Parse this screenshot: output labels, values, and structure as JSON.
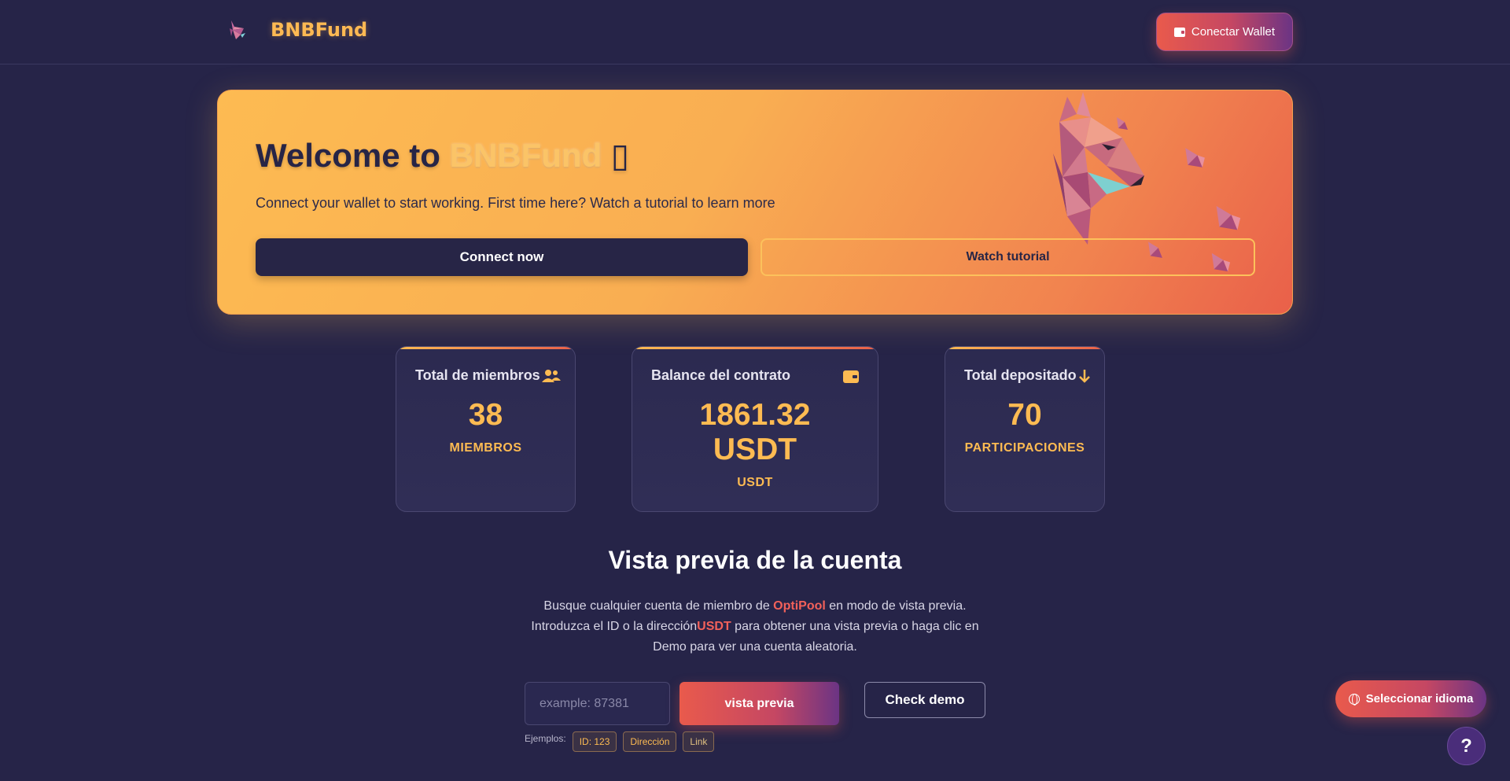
{
  "header": {
    "brand": "BNBFund",
    "connect_wallet_label": "Conectar Wallet"
  },
  "hero": {
    "title_prefix": "Welcome to ",
    "title_brand": "BNBFund",
    "title_suffix": " ▯",
    "subtitle": "Connect your wallet to start working. First time here? Watch a tutorial to learn more",
    "connect_now_label": "Connect now",
    "watch_tutorial_label": "Watch tutorial"
  },
  "stats": [
    {
      "title": "Total de miembros",
      "value": "38",
      "unit": "MIEMBROS",
      "icon": "users-icon"
    },
    {
      "title": "Balance del contrato",
      "value_line1": "1861.32",
      "value_line2": "USDT",
      "unit": "USDT",
      "icon": "wallet-icon"
    },
    {
      "title": "Total depositado",
      "value": "70",
      "unit": "PARTICIPACIONES",
      "icon": "arrow-down-icon"
    }
  ],
  "preview": {
    "title": "Vista previa de la cuenta",
    "desc_part1": "Busque cualquier cuenta de miembro de ",
    "desc_hl1": "OptiPool",
    "desc_part2": " en modo de vista previa. Introduzca el ID o la dirección",
    "desc_hl2": "USDT",
    "desc_part3": " para obtener una vista previa o haga clic en Demo para ver una cuenta aleatoria.",
    "search_placeholder": "example: 87381",
    "preview_button_label": "vista previa",
    "demo_button_label": "Check demo",
    "examples_label": "Ejemplos:",
    "examples": [
      "ID: 123",
      "Dirección",
      "Link"
    ]
  },
  "floating": {
    "language_label": "Seleccionar idioma",
    "help_label": "?"
  },
  "colors": {
    "background": "#262448",
    "accent_gold": "#fdbb52",
    "accent_red": "#e95a4c",
    "accent_purple": "#6b3484"
  }
}
